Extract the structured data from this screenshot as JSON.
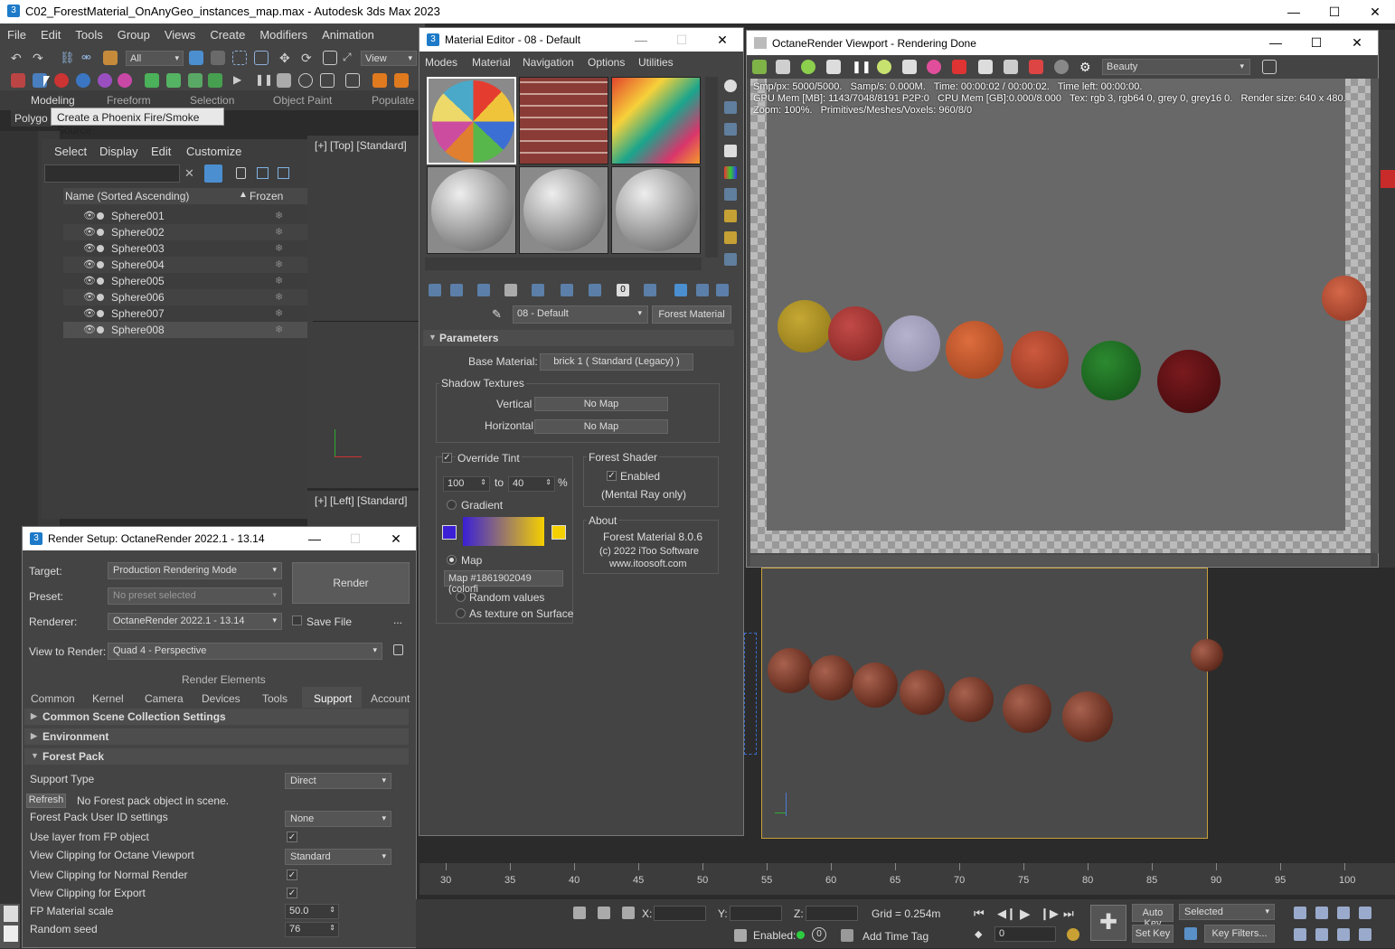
{
  "app": {
    "title": "C02_ForestMaterial_OnAnyGeo_instances_map.max - Autodesk 3ds Max 2023",
    "menu": [
      "File",
      "Edit",
      "Tools",
      "Group",
      "Views",
      "Create",
      "Modifiers",
      "Animation"
    ],
    "selection_filter": "All",
    "ref_coord": "View",
    "ribbon_tabs": [
      "Modeling",
      "Freeform",
      "Selection",
      "Object Paint",
      "Populate"
    ],
    "ribbon_sub": "Polygo",
    "tooltip": "Create a Phoenix Fire/Smoke Source"
  },
  "scene_explorer": {
    "menu": [
      "Select",
      "Display",
      "Edit",
      "Customize"
    ],
    "col_name": "Name (Sorted Ascending)",
    "col_frozen": "Frozen",
    "sort_indicator": "▲",
    "rows": [
      "Sphere001",
      "Sphere002",
      "Sphere003",
      "Sphere004",
      "Sphere005",
      "Sphere006",
      "Sphere007",
      "Sphere008"
    ]
  },
  "viewports": {
    "top_label": "[+] [Top] [Standard]",
    "left_label": "[+] [Left] [Standard]"
  },
  "render_setup": {
    "title": "Render Setup: OctaneRender 2022.1 - 13.14",
    "target_label": "Target:",
    "target_value": "Production Rendering Mode",
    "preset_label": "Preset:",
    "preset_value": "No preset selected",
    "renderer_label": "Renderer:",
    "renderer_value": "OctaneRender 2022.1 - 13.14",
    "save_file": "Save File",
    "ellipsis": "...",
    "view_label": "View to Render:",
    "view_value": "Quad 4 - Perspective",
    "render_button": "Render",
    "render_elements": "Render Elements",
    "tabs": [
      "Common",
      "Kernel",
      "Camera",
      "Devices",
      "Tools",
      "Support",
      "Account"
    ],
    "active_tab": "Support",
    "rollouts": [
      "Common Scene Collection Settings",
      "Environment",
      "Forest Pack"
    ],
    "support_type_label": "Support Type",
    "support_type_value": "Direct",
    "refresh": "Refresh",
    "no_forest": "No Forest pack object in scene.",
    "user_id_label": "Forest Pack User ID settings",
    "user_id_value": "None",
    "use_layer": "Use layer from FP object",
    "clip_octane_label": "View Clipping for Octane Viewport",
    "clip_octane_value": "Standard",
    "clip_normal": "View Clipping for Normal Render",
    "clip_export": "View Clipping for Export",
    "fp_scale_label": "FP Material scale",
    "fp_scale_value": "50.0",
    "seed_label": "Random seed",
    "seed_value": "76"
  },
  "material_editor": {
    "title": "Material Editor - 08 - Default",
    "menu": [
      "Modes",
      "Material",
      "Navigation",
      "Options",
      "Utilities"
    ],
    "material_name": "08 - Default",
    "material_type": "Forest Material",
    "params_title": "Parameters",
    "base_label": "Base Material:",
    "base_value": "brick 1  ( Standard (Legacy) )",
    "shadow_title": "Shadow Textures",
    "vertical": "Vertical",
    "horizontal": "Horizontal",
    "no_map": "No Map",
    "override_tint": "Override Tint",
    "tint_from": "100",
    "tint_to_label": "to",
    "tint_to": "40",
    "percent": "%",
    "gradient": "Gradient",
    "map": "Map",
    "map_value": "Map #1861902049 (colorfi",
    "random_values": "Random values",
    "as_texture": "As texture on Surface",
    "forest_shader": "Forest Shader",
    "enabled": "Enabled",
    "mental_ray": "(Mental Ray only)",
    "about_title": "About",
    "about_lines": [
      "Forest Material 8.0.6",
      "(c) 2022 iToo Software",
      "www.itoosoft.com"
    ],
    "gradient_from": "#3a1fd6",
    "gradient_to": "#f5d000"
  },
  "octane": {
    "title": "OctaneRender Viewport - Rendering Done",
    "pass": "Beauty",
    "info_line1": "Smp/px: 5000/5000.   Samp/s: 0.000M.   Time: 00:00:02 / 00:00:02.   Time left: 00:00:00.",
    "info_line2": "GPU Mem [MB]: 1143/7048/8191 P2P:0   CPU Mem [GB]:0.000/8.000   Tex: rgb 3, rgb64 0, grey 0, grey16 0.   Render size: 640 x 480.",
    "info_line3": "Zoom: 100%.   Primitives/Meshes/Voxels: 960/8/0"
  },
  "timeline": {
    "ticks": [
      "30",
      "35",
      "40",
      "45",
      "50",
      "55",
      "60",
      "65",
      "70",
      "75",
      "80",
      "85",
      "90",
      "95",
      "100"
    ]
  },
  "status": {
    "x_label": "X:",
    "y_label": "Y:",
    "z_label": "Z:",
    "grid": "Grid = 0.254m",
    "enabled": "Enabled:",
    "enabled_count": "0",
    "add_time_tag": "Add Time Tag",
    "auto_key": "Auto Key",
    "set_key": "Set Key",
    "selected": "Selected",
    "frame": "0",
    "key_filters": "Key Filters..."
  }
}
